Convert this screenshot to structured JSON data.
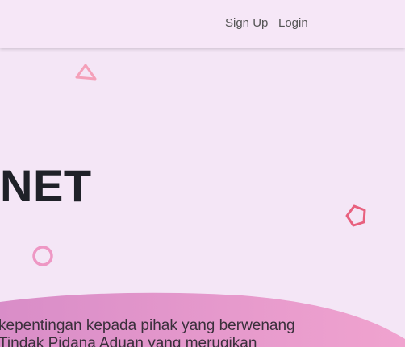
{
  "nav": {
    "signup_label": "Sign Up",
    "login_label": "Login"
  },
  "hero": {
    "title": ".NET",
    "description_lines": [
      "kepentingan kepada pihak yang berwenang",
      "Tindak Pidana Aduan yang merugikan"
    ]
  },
  "decorations": {
    "triangle_color": "#f4a0b9",
    "pentagon_color": "#e8607e",
    "circle_color": "#ee97c4",
    "wave_color_left": "#d98dc8",
    "wave_color_right": "#f0a3cf",
    "background": "#f4e6f6"
  },
  "icons": [
    "triangle-outline-icon",
    "pentagon-outline-icon",
    "circle-outline-icon"
  ]
}
